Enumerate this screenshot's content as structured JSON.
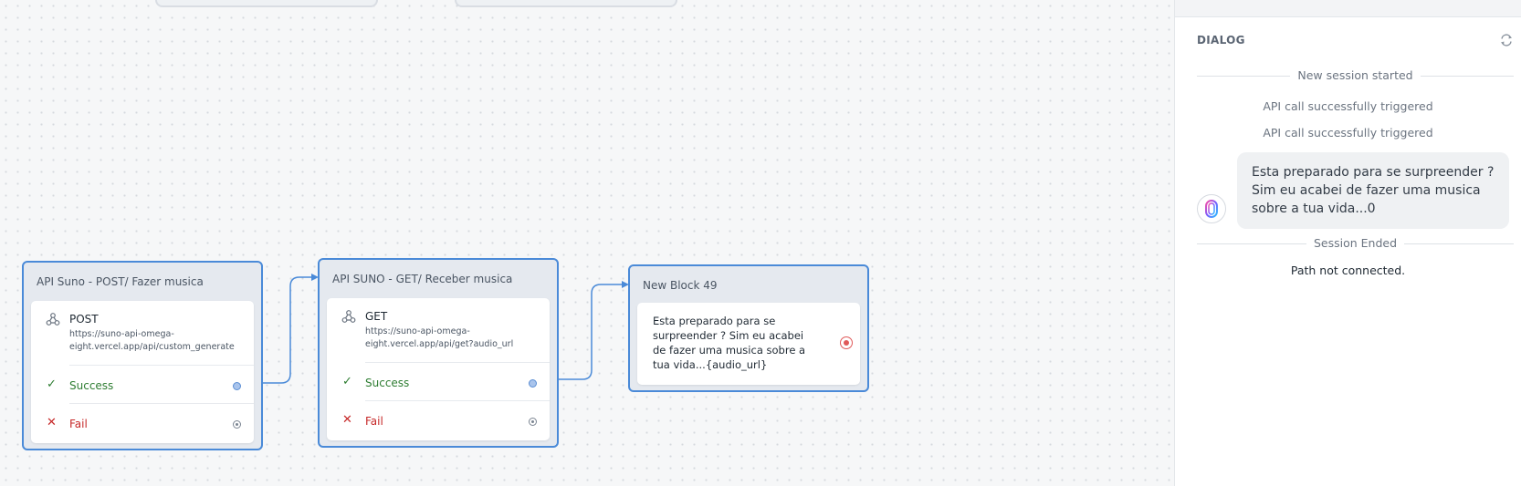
{
  "canvas": {
    "blocks": [
      {
        "title": "API Suno - POST/ Fazer musica",
        "method": "POST",
        "url": "https://suno-api-omega-eight.vercel.app/api/custom_generate",
        "success_label": "Success",
        "fail_label": "Fail"
      },
      {
        "title": "API SUNO - GET/ Receber musica",
        "method": "GET",
        "url": "https://suno-api-omega-eight.vercel.app/api/get?audio_url",
        "success_label": "Success",
        "fail_label": "Fail"
      },
      {
        "title": "New Block 49",
        "message": "Esta preparado para se surpreender ? Sim eu acabei de fazer uma musica sobre a tua vida...{audio_url}"
      }
    ]
  },
  "dialog": {
    "title": "DIALOG",
    "session_started": "New session started",
    "events": [
      "API call successfully triggered",
      "API call successfully triggered"
    ],
    "bot_message": "Esta preparado para se surpreender ? Sim eu acabei de fazer uma musica sobre a tua vida...0",
    "session_ended": "Session Ended",
    "path_note": "Path not connected."
  },
  "colors": {
    "accent": "#4a8ad8",
    "success": "#2e7d32",
    "fail": "#c62828"
  }
}
